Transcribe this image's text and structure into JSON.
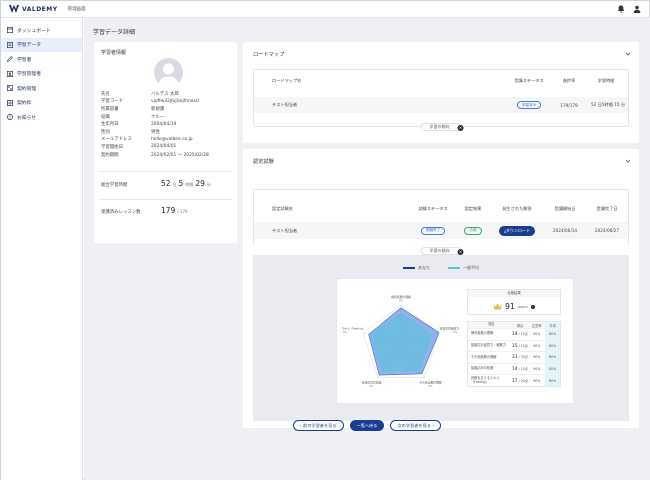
{
  "header": {
    "brand": "VALDEMY",
    "admin_label": "管理画面"
  },
  "sidebar": {
    "items": [
      {
        "label": "ダッシュボード",
        "icon": "dashboard-icon"
      },
      {
        "label": "学習データ",
        "icon": "learning-data-icon",
        "active": true
      },
      {
        "label": "学習者",
        "icon": "user-icon"
      },
      {
        "label": "学習管理者",
        "icon": "admin-icon"
      },
      {
        "label": "契約管理",
        "icon": "contract-icon"
      },
      {
        "label": "契約枠",
        "icon": "quota-icon"
      },
      {
        "label": "お知らせ",
        "icon": "notice-icon"
      }
    ]
  },
  "main": {
    "page_title": "学習データ詳細"
  },
  "learner": {
    "title": "学習者情報",
    "rows": [
      {
        "k": "氏名",
        "v": "バルデス 太郎"
      },
      {
        "k": "学習コード",
        "v": "vjoftw32jfojUojfnnesU"
      },
      {
        "k": "所属部署",
        "v": "新規課"
      },
      {
        "k": "役職",
        "v": "クルー"
      },
      {
        "k": "生年月日",
        "v": "2004/04/19"
      },
      {
        "k": "性別",
        "v": "男性"
      },
      {
        "k": "メールアドレス",
        "v": "hello@valbee.co.jp"
      },
      {
        "k": "学習開始日",
        "v": "2024/04/01"
      },
      {
        "k": "契約期間",
        "v": "2024/02/01 ～ 2025/02/28"
      }
    ],
    "total_time_label": "総合学習時間",
    "total_hours": "52",
    "hours_unit": "日",
    "total_hours2": "5",
    "hours_unit2": "時間",
    "total_minutes": "29",
    "minutes_unit": "分",
    "lessons_label": "受講済みレッスン数",
    "lessons_done": "179",
    "lessons_total": "/ 179"
  },
  "roadmap": {
    "title": "ロードマップ",
    "headers": [
      "ロードマップ名",
      "受講ステータス",
      "進捗率",
      "学習時間"
    ],
    "row": {
      "name": "テスト担当者",
      "status": "学習済み",
      "progress": "179/179",
      "time": "52 日5時間 15 分"
    },
    "toggle": "学習の傾向"
  },
  "exam": {
    "title": "認定試験",
    "headers": [
      "認定試験名",
      "試験ステータス",
      "認定結果",
      "発生された解答",
      "受講開始日",
      "受講完了日"
    ],
    "row": {
      "name": "テスト担当者",
      "status": "受験終了",
      "result": "合格",
      "download": "ダウンロード",
      "start": "2024/06/14",
      "end": "2024/06/27"
    },
    "toggle": "学習の傾向"
  },
  "chart_legend": {
    "you": "あなた",
    "average": "一般平均"
  },
  "colors": {
    "navy": "#1a3e8f",
    "you": "#3b6fd6",
    "average": "#54c6d8"
  },
  "score": {
    "head": "合格結果",
    "value": "91",
    "unit": "/point"
  },
  "score_table": {
    "headers": [
      "項目",
      "得点",
      "正答率",
      "平均"
    ],
    "rows": [
      {
        "item": "権利義務の理解",
        "score": "14",
        "max": "/ 15点",
        "rate": "90%",
        "avg": "80%"
      },
      {
        "item": "接客応対品質力・観察力",
        "score": "15",
        "max": "/ 15点",
        "rate": "90%",
        "avg": "80%"
      },
      {
        "item": "その他実務の理解",
        "score": "31",
        "max": "/ 35点",
        "rate": "90%",
        "avg": "80%"
      },
      {
        "item": "接客応対の知識",
        "score": "14",
        "max": "/ 15点",
        "rate": "90%",
        "avg": "80%"
      },
      {
        "item": "判断を支えるスキル（Feeling）",
        "score": "17",
        "max": "/ 20点",
        "rate": "90%",
        "avg": "80%"
      }
    ]
  },
  "chart_data": {
    "type": "radar",
    "categories": [
      "権利義務の理解",
      "接客応対品質力・観察力",
      "その他実務の理解",
      "接客応対の知識",
      "判断を支えるスキル（Feeling）"
    ],
    "tick_label": "0%",
    "rlim": [
      0,
      100
    ],
    "series": [
      {
        "name": "あなた",
        "values": [
          93,
          100,
          89,
          93,
          85
        ]
      },
      {
        "name": "一般平均",
        "values": [
          80,
          80,
          80,
          80,
          80
        ]
      }
    ]
  },
  "footer": {
    "prev": "前の学習者を見る",
    "list": "一覧へ戻る",
    "next": "次の学習者を見る"
  }
}
